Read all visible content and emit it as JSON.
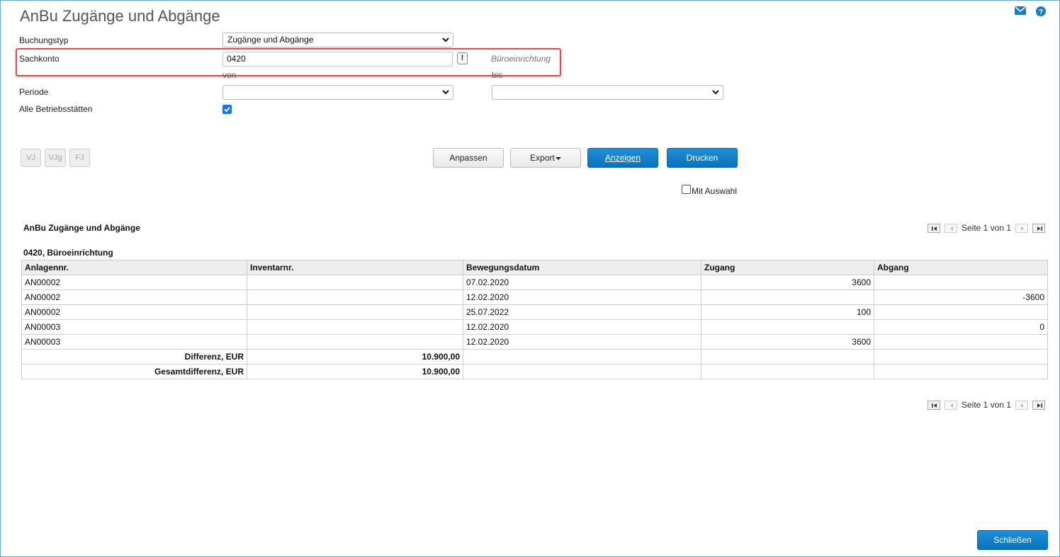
{
  "window": {
    "title": "AnBu Zugänge und Abgänge"
  },
  "header_icons": {
    "mail": "mail-icon",
    "help": "help-icon"
  },
  "form": {
    "buchungstyp": {
      "label": "Buchungstyp",
      "value": "Zugänge und Abgänge"
    },
    "sachkonto": {
      "label": "Sachkonto",
      "value": "0420",
      "hint": "Büroeinrichtung"
    },
    "periode": {
      "label": "Periode",
      "von_label": "von",
      "bis_label": "bis",
      "von_value": "",
      "bis_value": ""
    },
    "alle_betriebsstaetten": {
      "label": "Alle Betriebsstätten",
      "checked": true
    }
  },
  "quick_buttons": [
    "VJ",
    "VJg",
    "FJ"
  ],
  "toolbar": {
    "anpassen": "Anpassen",
    "export": "Export",
    "anzeigen": "Anzeigen",
    "drucken": "Drucken",
    "mit_auswahl": "Mit Auswahl"
  },
  "report": {
    "title": "AnBu Zugänge und Abgänge",
    "pager": {
      "label": "Seite 1 von 1"
    },
    "group_title": "0420, Büroeinrichtung",
    "columns": [
      "Anlagennr.",
      "Inventarnr.",
      "Bewegungsdatum",
      "Zugang",
      "Abgang"
    ],
    "rows": [
      [
        "AN00002",
        "",
        "07.02.2020",
        "3600",
        ""
      ],
      [
        "AN00002",
        "",
        "12.02.2020",
        "",
        "-3600"
      ],
      [
        "AN00002",
        "",
        "25.07.2022",
        "100",
        ""
      ],
      [
        "AN00003",
        "",
        "12.02.2020",
        "",
        "0"
      ],
      [
        "AN00003",
        "",
        "12.02.2020",
        "3600",
        ""
      ]
    ],
    "totals": [
      {
        "label": "Differenz, EUR",
        "value": "10.900,00"
      },
      {
        "label": "Gesamtdifferenz, EUR",
        "value": "10.900,00"
      }
    ]
  },
  "footer": {
    "close": "Schließen"
  },
  "colors": {
    "accent": "#0a72bb",
    "highlight": "#e34b4b",
    "checkbox": "#1a73e8"
  }
}
